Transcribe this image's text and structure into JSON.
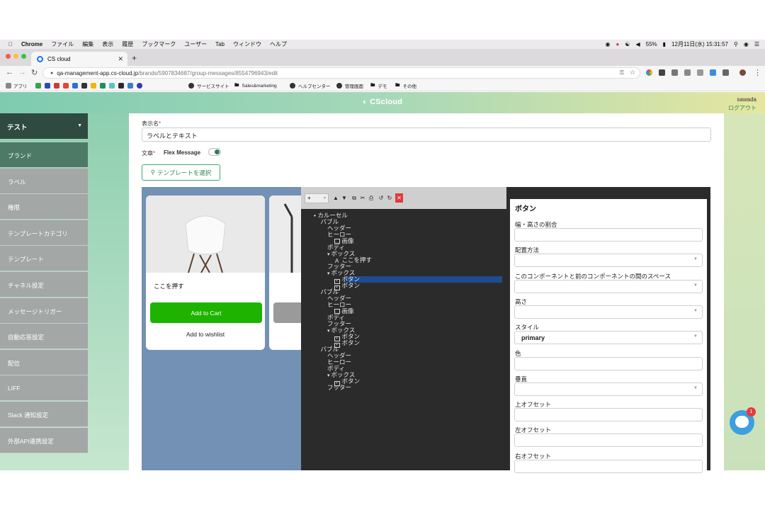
{
  "macbar": {
    "apple": "",
    "items": [
      "Chrome",
      "ファイル",
      "編集",
      "表示",
      "履歴",
      "ブックマーク",
      "ユーザー",
      "Tab",
      "ウィンドウ",
      "ヘルプ"
    ],
    "battery": "55%",
    "datetime": "12月11日(水) 15:31:57"
  },
  "browser": {
    "tab_title": "CS cloud",
    "url_host": "qa-management-app.cs-cloud.jp",
    "url_path": "/brands/5907834687/group-messages/8554796943/edit",
    "bookmarks": [
      "アプリ",
      "サービスサイト",
      "Sales&marketing",
      "ヘルプセンター",
      "管理画面",
      "デモ",
      "その他"
    ]
  },
  "header": {
    "logo": "CScloud",
    "user": "sawada",
    "logout": "ログアウト"
  },
  "sidebar": {
    "brand": "テスト",
    "items": [
      {
        "label": "ブランド"
      },
      {
        "label": "ラベル"
      },
      {
        "label": "権限"
      },
      {
        "label": "テンプレートカテゴリ"
      },
      {
        "label": "テンプレート"
      },
      {
        "label": "チャネル設定"
      },
      {
        "label": "メッセージトリガー"
      },
      {
        "label": "自動応答設定"
      },
      {
        "label": "配信"
      },
      {
        "label": "LIFF"
      },
      {
        "label": "Slack 通知設定"
      },
      {
        "label": "外部API連携設定"
      }
    ]
  },
  "form": {
    "display_name_label": "表示名",
    "display_name_value": "ラベルとテキスト",
    "text_label": "文章",
    "flex_label": "Flex Message",
    "flex_enabled": true,
    "template_button": "テンプレートを選択",
    "required_mark": "*"
  },
  "preview": {
    "card_text": "ここを押す",
    "cart_button": "Add to Cart",
    "wishlist": "Add to wishlist",
    "cart_color": "#1db300"
  },
  "tree": {
    "add_label": "+",
    "nodes": [
      {
        "label": "カルーセル",
        "kind": "bullet"
      },
      {
        "label": "バブル"
      },
      {
        "label": "ヘッダー"
      },
      {
        "label": "ヒーロー"
      },
      {
        "label": "画像",
        "icon": "image"
      },
      {
        "label": "ボディ"
      },
      {
        "label": "ボックス",
        "kind": "toggle"
      },
      {
        "label": "ここを押す",
        "icon": "text"
      },
      {
        "label": "フッター"
      },
      {
        "label": "ボックス",
        "kind": "toggle"
      },
      {
        "label": "ボタン",
        "icon": "button",
        "selected": true
      },
      {
        "label": "ボタン",
        "icon": "button"
      },
      {
        "label": "バブル"
      },
      {
        "label": "ヘッダー"
      },
      {
        "label": "ヒーロー"
      },
      {
        "label": "画像",
        "icon": "image"
      },
      {
        "label": "ボディ"
      },
      {
        "label": "フッター"
      },
      {
        "label": "ボックス",
        "kind": "toggle"
      },
      {
        "label": "ボタン",
        "icon": "button"
      },
      {
        "label": "ボタン",
        "icon": "button"
      },
      {
        "label": "バブル"
      },
      {
        "label": "ヘッダー"
      },
      {
        "label": "ヒーロー"
      },
      {
        "label": "ボディ"
      },
      {
        "label": "ボックス",
        "kind": "toggle"
      },
      {
        "label": "ボタン",
        "icon": "button"
      },
      {
        "label": "フッター"
      }
    ]
  },
  "props": {
    "title": "ボタン",
    "fields": [
      {
        "label": "幅・高さの割合",
        "value": "",
        "select": false
      },
      {
        "label": "配置方法",
        "value": "",
        "select": true
      },
      {
        "label": "このコンポーネントと前のコンポーネントの間のスペース",
        "value": "",
        "select": true
      },
      {
        "label": "高さ",
        "value": "",
        "select": true
      },
      {
        "label": "スタイル",
        "value": "primary",
        "select": true
      },
      {
        "label": "色",
        "value": "",
        "select": false
      },
      {
        "label": "垂直",
        "value": "",
        "select": true
      },
      {
        "label": "上オフセット",
        "value": "",
        "select": false
      },
      {
        "label": "左オフセット",
        "value": "",
        "select": false
      },
      {
        "label": "右オフセット",
        "value": "",
        "select": false
      }
    ]
  },
  "chat": {
    "badge": "1"
  }
}
